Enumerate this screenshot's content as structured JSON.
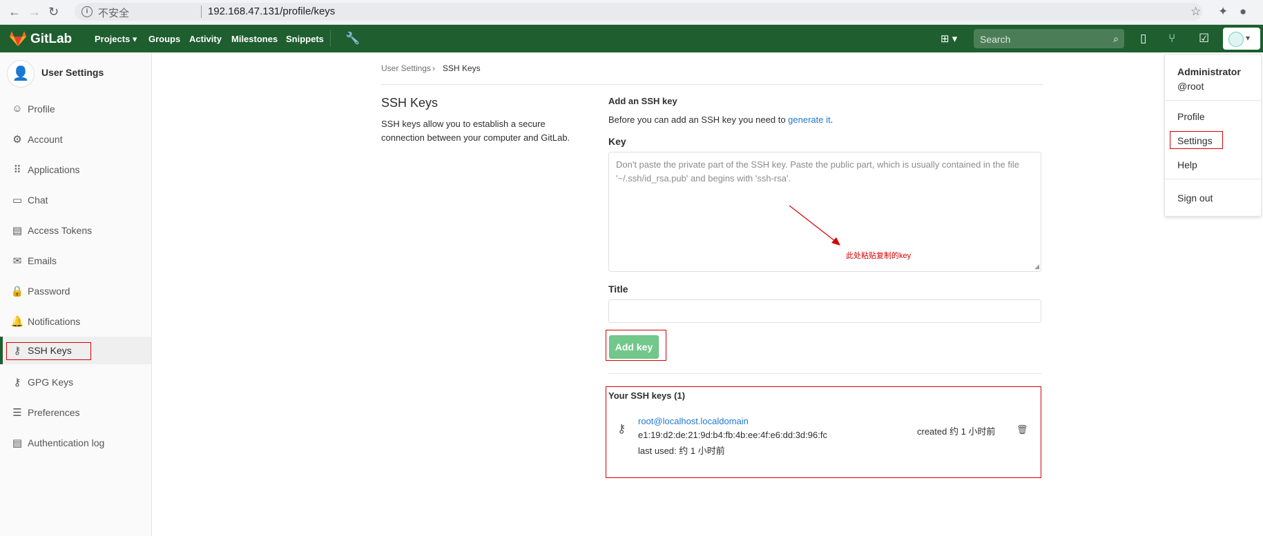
{
  "browser": {
    "insecure_label": "不安全",
    "url": "192.168.47.131/profile/keys"
  },
  "header": {
    "brand": "GitLab",
    "menu": [
      "Projects",
      "Groups",
      "Activity",
      "Milestones",
      "Snippets"
    ],
    "search_placeholder": "Search"
  },
  "sidebar": {
    "title": "User Settings",
    "items": [
      {
        "label": "Profile"
      },
      {
        "label": "Account"
      },
      {
        "label": "Applications"
      },
      {
        "label": "Chat"
      },
      {
        "label": "Access Tokens"
      },
      {
        "label": "Emails"
      },
      {
        "label": "Password"
      },
      {
        "label": "Notifications"
      },
      {
        "label": "SSH Keys"
      },
      {
        "label": "GPG Keys"
      },
      {
        "label": "Preferences"
      },
      {
        "label": "Authentication log"
      }
    ]
  },
  "breadcrumb": {
    "parent": "User Settings",
    "current": "SSH Keys"
  },
  "page": {
    "title": "SSH Keys",
    "description": "SSH keys allow you to establish a secure connection between your computer and GitLab.",
    "add_heading": "Add an SSH key",
    "before_text": "Before you can add an SSH key you need to ",
    "generate_link": "generate it",
    "before_end": ".",
    "key_label": "Key",
    "key_placeholder": "Don't paste the private part of the SSH key. Paste the public part, which is usually contained in the file '~/.ssh/id_rsa.pub' and begins with 'ssh-rsa'.",
    "annotation": "此处粘贴复制的key",
    "title_label": "Title",
    "add_button": "Add key",
    "keys_heading": "Your SSH keys (1)",
    "keys": [
      {
        "name": "root@localhost.localdomain",
        "fingerprint": "e1:19:d2:de:21:9d:b4:fb:4b:ee:4f:e6:dd:3d:96:fc",
        "last_used": "last used: 约 1 小时前",
        "created": "created 约 1 小时前"
      }
    ]
  },
  "dropdown": {
    "name": "Administrator",
    "username": "@root",
    "items": [
      "Profile",
      "Settings",
      "Help",
      "Sign out"
    ]
  },
  "colors": {
    "header": "#1e5e2f",
    "link": "#1f78d1",
    "annotation": "#d40000",
    "add_button": "#72c88b"
  }
}
